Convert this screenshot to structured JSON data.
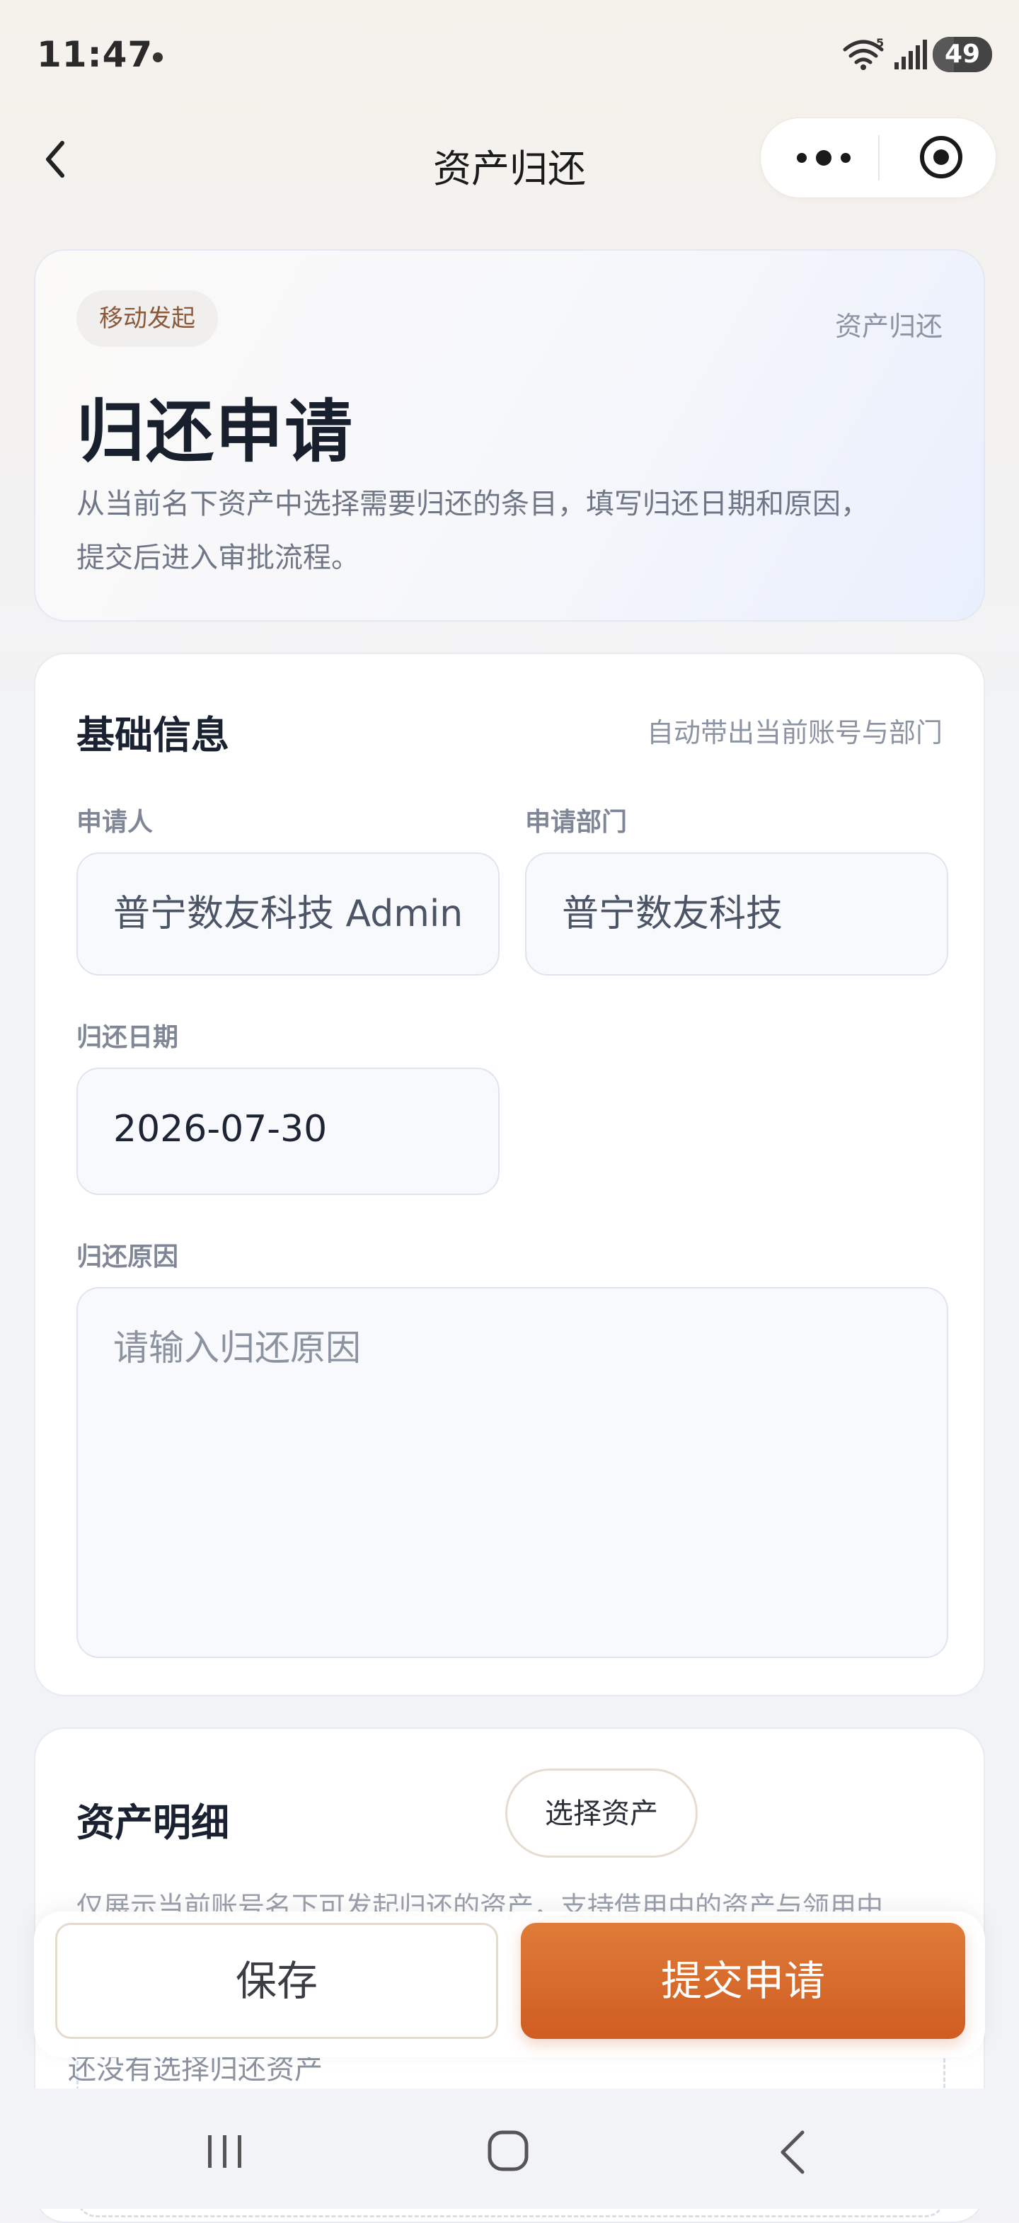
{
  "status_bar": {
    "time": "11:47",
    "battery": "49",
    "wifi_badge": "5"
  },
  "nav": {
    "title": "资产归还"
  },
  "hero": {
    "badge": "移动发起",
    "tag": "资产归还",
    "title": "归还申请",
    "description_line1": "从当前名下资产中选择需要归还的条目，填写归还日期和原因，",
    "description_line2": "提交后进入审批流程。"
  },
  "basic_info": {
    "title": "基础信息",
    "hint": "自动带出当前账号与部门",
    "applicant_label": "申请人",
    "applicant_value": "普宁数友科技 Admin",
    "department_label": "申请部门",
    "department_value": "普宁数友科技",
    "return_date_label": "归还日期",
    "return_date_value": "2026-07-30",
    "reason_label": "归还原因",
    "reason_placeholder": "请输入归还原因"
  },
  "assets": {
    "title": "资产明细",
    "select_button": "选择资产",
    "description": "仅展示当前账号名下可发起归还的资产，支持借用中的资产与领用中",
    "empty_text": "还没有选择归还资产"
  },
  "actions": {
    "save": "保存",
    "submit": "提交申请"
  },
  "colors": {
    "accent": "#d96a2b",
    "badge_text": "#8a5a3b",
    "muted": "#8c94a3"
  }
}
